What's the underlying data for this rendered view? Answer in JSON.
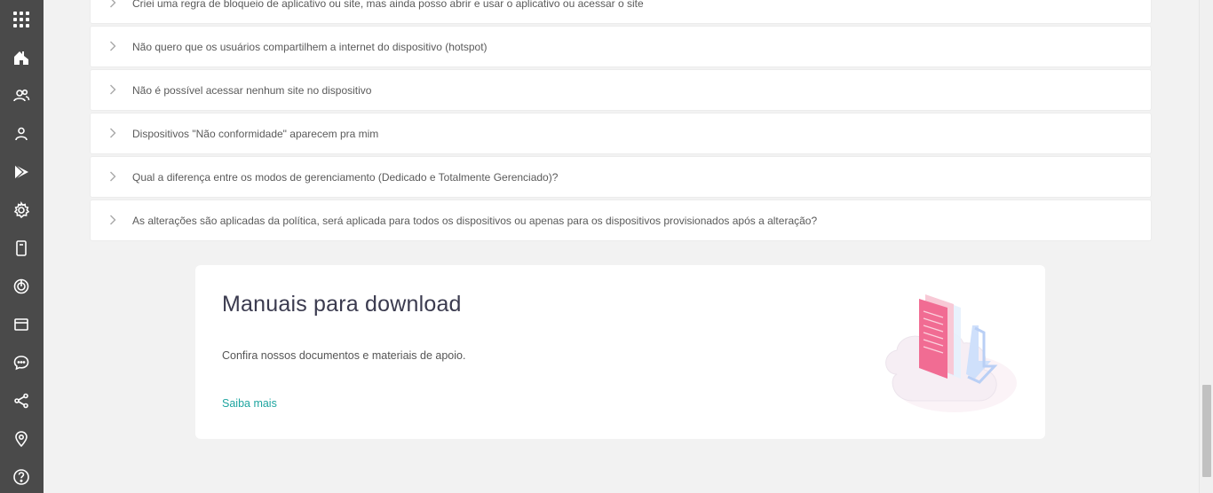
{
  "sidebar": {
    "background": "#4a4a4a",
    "icons": [
      {
        "name": "apps-grid-icon"
      },
      {
        "name": "home-icon"
      },
      {
        "name": "users-group-icon"
      },
      {
        "name": "user-icon"
      },
      {
        "name": "play-store-icon"
      },
      {
        "name": "settings-gear-icon"
      },
      {
        "name": "device-icon"
      },
      {
        "name": "target-icon"
      },
      {
        "name": "browser-window-icon"
      },
      {
        "name": "chat-icon"
      },
      {
        "name": "share-icon"
      },
      {
        "name": "location-pin-icon"
      },
      {
        "name": "help-icon"
      }
    ]
  },
  "faq": {
    "items": [
      {
        "label": "Criei uma regra de bloqueio de aplicativo ou site, mas ainda posso abrir e usar o aplicativo ou acessar o site"
      },
      {
        "label": "Não quero que os usuários compartilhem a internet do dispositivo (hotspot)"
      },
      {
        "label": "Não é possível acessar nenhum site no dispositivo"
      },
      {
        "label": "Dispositivos \"Não conformidade\" aparecem pra mim"
      },
      {
        "label": "Qual a diferença entre os modos de gerenciamento (Dedicado e Totalmente Gerenciado)?"
      },
      {
        "label": "As alterações são aplicadas da política, será aplicada para todos os dispositivos ou apenas para os dispositivos provisionados após a alteração?"
      }
    ]
  },
  "downloads": {
    "title": "Manuais para download",
    "description": "Confira nossos documentos e materiais de apoio.",
    "link": "Saiba mais",
    "link_color": "#1fa5a0"
  }
}
